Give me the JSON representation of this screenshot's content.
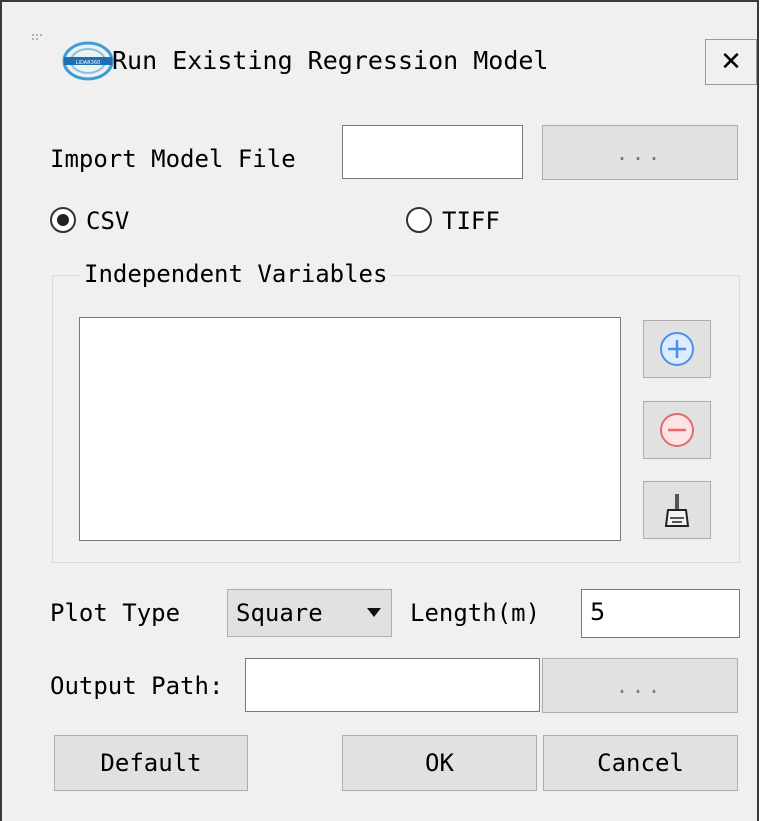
{
  "window": {
    "title": "Run Existing Regression Model",
    "close_label": "✕"
  },
  "import": {
    "label": "Import Model File",
    "value": "",
    "browse_label": "..."
  },
  "format": {
    "options": [
      {
        "label": "CSV",
        "checked": true
      },
      {
        "label": "TIFF",
        "checked": false
      }
    ]
  },
  "variables": {
    "group_title": "Independent Variables",
    "items": [],
    "add_icon": "plus-circle-icon",
    "remove_icon": "minus-circle-icon",
    "clear_icon": "brush-icon"
  },
  "plot": {
    "type_label": "Plot Type",
    "type_value": "Square",
    "length_label": "Length(m)",
    "length_value": "5"
  },
  "output": {
    "label": "Output Path:",
    "value": "",
    "browse_label": "..."
  },
  "buttons": {
    "default_label": "Default",
    "ok_label": "OK",
    "cancel_label": "Cancel"
  },
  "colors": {
    "add": "#4d8fe8",
    "remove": "#e36b6b"
  }
}
